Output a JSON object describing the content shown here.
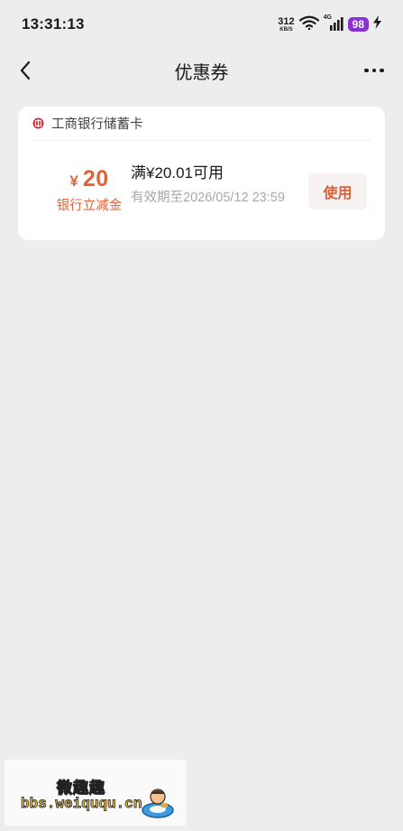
{
  "status_bar": {
    "time": "13:31:13",
    "net_speed_value": "312",
    "net_speed_unit": "KB/S",
    "network_type": "4G",
    "battery": "98",
    "icons": [
      "wifi-icon",
      "signal-icon",
      "charging-icon"
    ]
  },
  "nav": {
    "title": "优惠券",
    "back_icon": "chevron-left-icon",
    "more_icon": "more-dots-icon"
  },
  "coupon": {
    "bank_name": "工商银行储蓄卡",
    "currency_symbol": "¥",
    "amount": "20",
    "amount_label": "银行立减金",
    "condition": "满¥20.01可用",
    "validity": "有效期至2026/05/12 23:59",
    "use_label": "使用",
    "accent_color": "#e1643c"
  },
  "watermark": {
    "title": "微趣趣",
    "url": "bbs.weiququ.cn"
  }
}
